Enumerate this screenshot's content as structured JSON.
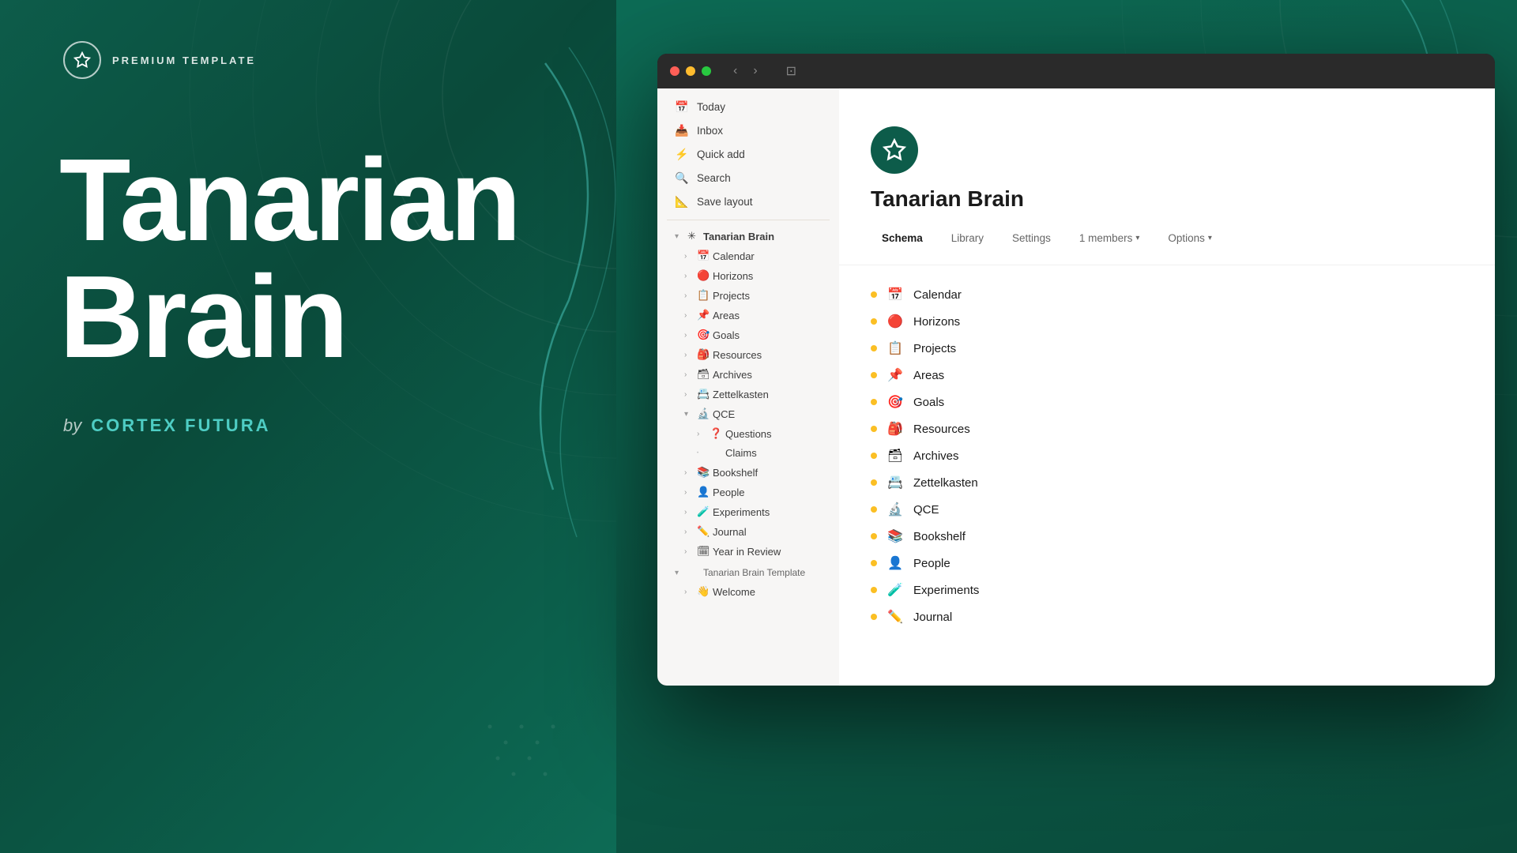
{
  "left": {
    "badge_icon": "✳",
    "badge_text": "PREMIUM TEMPLATE",
    "title_line1": "Tanarian",
    "title_line2": "Brain",
    "author_by": "by",
    "author_name": "CORTEX FUTURA"
  },
  "titlebar": {
    "back_label": "‹",
    "forward_label": "›",
    "sidebar_icon": "⊡"
  },
  "sidebar": {
    "nav_items": [
      {
        "icon": "📅",
        "label": "Today"
      },
      {
        "icon": "📥",
        "label": "Inbox"
      },
      {
        "icon": "⚡",
        "label": "Quick add"
      },
      {
        "icon": "🔍",
        "label": "Search"
      },
      {
        "icon": "📐",
        "label": "Save layout"
      }
    ],
    "tree": [
      {
        "level": 0,
        "expanded": true,
        "emoji": "✳",
        "label": "Tanarian Brain",
        "chevron": "▾",
        "is_workspace": true
      },
      {
        "level": 1,
        "expanded": false,
        "emoji": "📅",
        "label": "Calendar",
        "chevron": "›"
      },
      {
        "level": 1,
        "expanded": false,
        "emoji": "🔴",
        "label": "Horizons",
        "chevron": "›"
      },
      {
        "level": 1,
        "expanded": false,
        "emoji": "📋",
        "label": "Projects",
        "chevron": "›"
      },
      {
        "level": 1,
        "expanded": false,
        "emoji": "📌",
        "label": "Areas",
        "chevron": "›"
      },
      {
        "level": 1,
        "expanded": false,
        "emoji": "🎯",
        "label": "Goals",
        "chevron": "›"
      },
      {
        "level": 1,
        "expanded": false,
        "emoji": "🎒",
        "label": "Resources",
        "chevron": "›"
      },
      {
        "level": 1,
        "expanded": false,
        "emoji": "🗃",
        "label": "Archives",
        "chevron": "›"
      },
      {
        "level": 1,
        "expanded": false,
        "emoji": "📇",
        "label": "Zettelkasten",
        "chevron": "›"
      },
      {
        "level": 1,
        "expanded": true,
        "emoji": "🔬",
        "label": "QCE",
        "chevron": "▾"
      },
      {
        "level": 2,
        "expanded": false,
        "emoji": "❓",
        "label": "Questions",
        "chevron": "›"
      },
      {
        "level": 2,
        "expanded": false,
        "emoji": "",
        "label": "Claims",
        "dot": true
      },
      {
        "level": 1,
        "expanded": false,
        "emoji": "📚",
        "label": "Bookshelf",
        "chevron": "›"
      },
      {
        "level": 1,
        "expanded": false,
        "emoji": "👤",
        "label": "People",
        "chevron": "›"
      },
      {
        "level": 1,
        "expanded": false,
        "emoji": "🧪",
        "label": "Experiments",
        "chevron": "›"
      },
      {
        "level": 1,
        "expanded": false,
        "emoji": "✏️",
        "label": "Journal",
        "chevron": "›"
      },
      {
        "level": 1,
        "expanded": false,
        "emoji": "🗓",
        "label": "Year in Review",
        "chevron": "›"
      },
      {
        "level": 0,
        "expanded": true,
        "emoji": "",
        "label": "Tanarian Brain Template",
        "chevron": "▾"
      },
      {
        "level": 1,
        "expanded": false,
        "emoji": "👋",
        "label": "Welcome",
        "chevron": "›"
      }
    ]
  },
  "workspace": {
    "logo_icon": "✳",
    "name": "Tanarian Brain",
    "tabs": [
      "Schema",
      "Library",
      "Settings"
    ],
    "active_tab": "Schema",
    "members_label": "1 members",
    "options_label": "Options"
  },
  "item_list": [
    {
      "bullet_color": "#d4d0c8",
      "icon": "📅",
      "name": "Calendar"
    },
    {
      "bullet_color": "#d4d0c8",
      "icon": "🔴",
      "name": "Horizons"
    },
    {
      "bullet_color": "#d4d0c8",
      "icon": "📋",
      "name": "Projects"
    },
    {
      "bullet_color": "#d4d0c8",
      "icon": "📌",
      "name": "Areas"
    },
    {
      "bullet_color": "#d4d0c8",
      "icon": "🎯",
      "name": "Goals"
    },
    {
      "bullet_color": "#d4d0c8",
      "icon": "🎒",
      "name": "Resources"
    },
    {
      "bullet_color": "#d4d0c8",
      "icon": "🗃",
      "name": "Archives"
    },
    {
      "bullet_color": "#d4d0c8",
      "icon": "📇",
      "name": "Zettelkasten"
    },
    {
      "bullet_color": "#d4d0c8",
      "icon": "🔬",
      "name": "QCE"
    },
    {
      "bullet_color": "#d4d0c8",
      "icon": "📚",
      "name": "Bookshelf"
    },
    {
      "bullet_color": "#d4d0c8",
      "icon": "👤",
      "name": "People"
    },
    {
      "bullet_color": "#d4d0c8",
      "icon": "🧪",
      "name": "Experiments"
    },
    {
      "bullet_color": "#d4d0c8",
      "icon": "✏️",
      "name": "Journal"
    }
  ],
  "colors": {
    "bg_dark": "#0d5c4a",
    "teal_accent": "#4ecdc4",
    "sidebar_bg": "#f7f6f5"
  }
}
